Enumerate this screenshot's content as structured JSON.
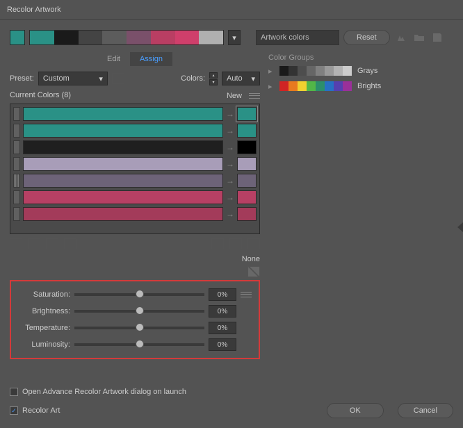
{
  "title": "Recolor Artwork",
  "top": {
    "active_color": "#2a9186",
    "strip": [
      "#2a9186",
      "#1a1a1a",
      "#444",
      "#5c5c5c",
      "#7a506a",
      "#b93e63",
      "#cf3f6b",
      "#b0b0b0"
    ],
    "method_field": "Artwork colors",
    "reset": "Reset"
  },
  "tabs": {
    "edit": "Edit",
    "assign": "Assign",
    "active": "assign"
  },
  "preset_label": "Preset:",
  "preset_value": "Custom",
  "colors_label": "Colors:",
  "colors_value": "Auto",
  "current": {
    "label": "Current Colors (8)",
    "new": "New"
  },
  "rows": [
    {
      "bar": "#2a9186",
      "new": "#2a9186",
      "sel": true,
      "handle": "block"
    },
    {
      "bar": "#2a9186",
      "new": "#2a9186",
      "handle": "block"
    },
    {
      "bar": "#1f1f1f",
      "new": "#000",
      "handle": "block"
    },
    {
      "bar": "#a89db8",
      "new": "#a89db8",
      "handle": "block"
    },
    {
      "bar": "#6d6378",
      "new": "#6d6378",
      "handle": "line"
    },
    {
      "bar": "#b74064",
      "new": "#b74064",
      "handle": "block"
    },
    {
      "bar": "#a33b5a",
      "new": "#a33b5a",
      "handle": "block"
    }
  ],
  "none": "None",
  "sliders": [
    {
      "label": "Saturation:",
      "val": "0%"
    },
    {
      "label": "Brightness:",
      "val": "0%"
    },
    {
      "label": "Temperature:",
      "val": "0%"
    },
    {
      "label": "Luminosity:",
      "val": "0%"
    }
  ],
  "groups": {
    "header": "Color Groups",
    "items": [
      {
        "name": "Grays",
        "colors": [
          "#1a1a1a",
          "#333",
          "#4d4d4d",
          "#666",
          "#808080",
          "#999",
          "#b3b3b3",
          "#ccc"
        ]
      },
      {
        "name": "Brights",
        "colors": [
          "#d02424",
          "#e87a1f",
          "#f0d030",
          "#52b648",
          "#2c8f6b",
          "#2770c4",
          "#5540b0",
          "#9a3099"
        ]
      }
    ]
  },
  "footer": {
    "adv": "Open Advance Recolor Artwork dialog on launch",
    "recolor": "Recolor Art",
    "ok": "OK",
    "cancel": "Cancel"
  }
}
